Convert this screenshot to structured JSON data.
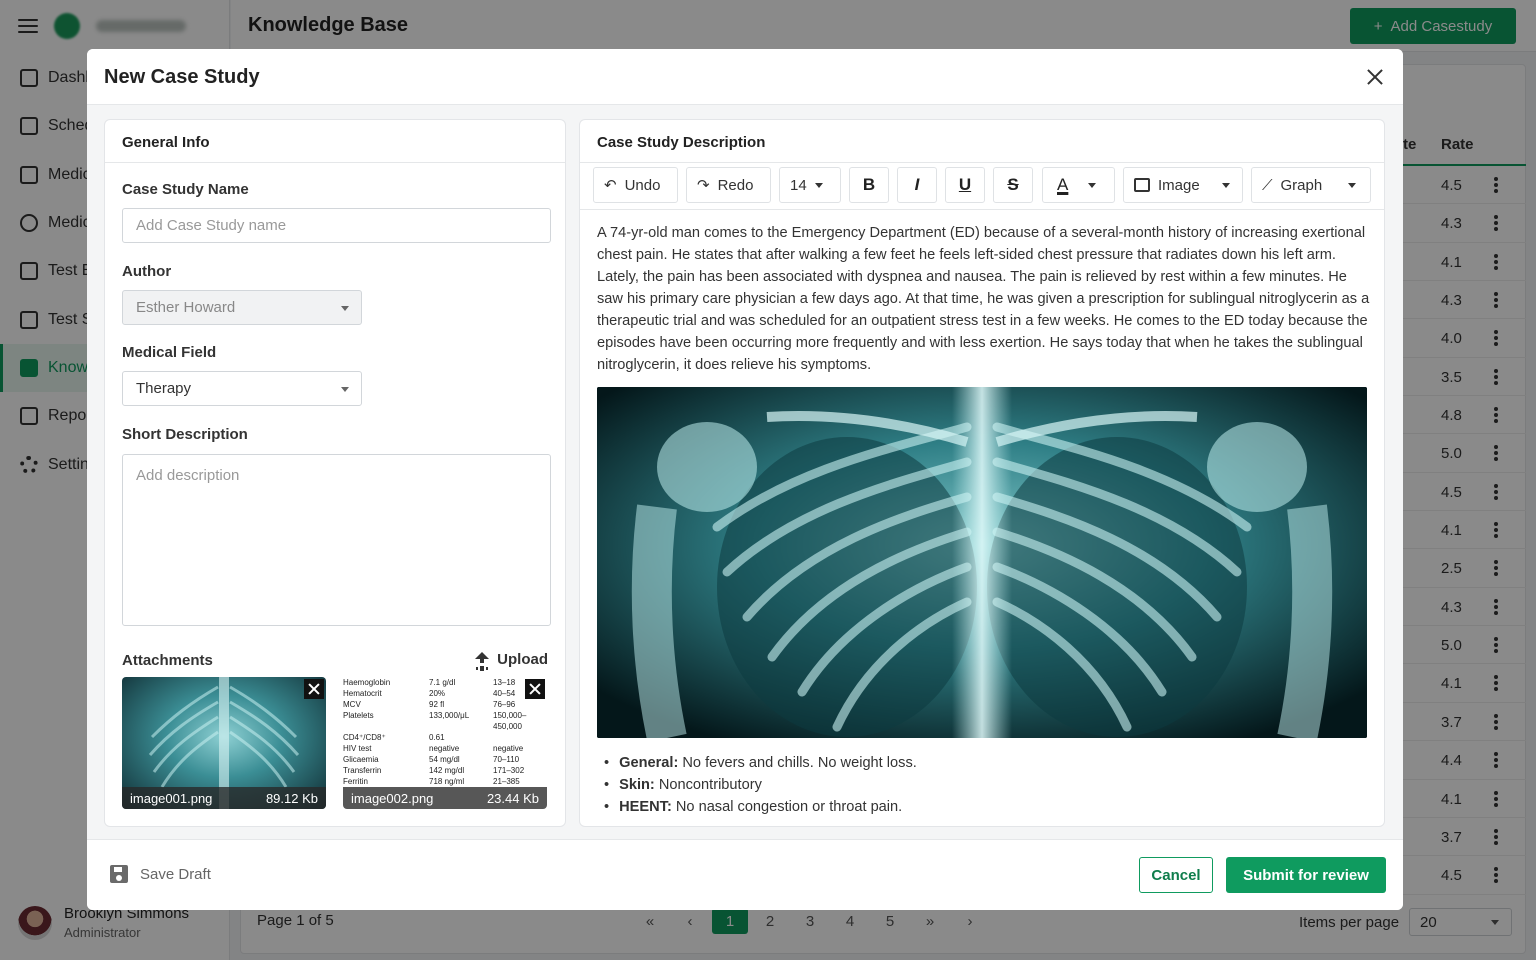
{
  "app": {
    "page_title": "Knowledge Base",
    "add_button": "Add Casestudy",
    "sidebar": {
      "items": [
        {
          "label": "Dashb",
          "icon": "dashboard-icon"
        },
        {
          "label": "Sched",
          "icon": "calendar-icon"
        },
        {
          "label": "Medic",
          "icon": "book-icon"
        },
        {
          "label": "Medic",
          "icon": "people-icon"
        },
        {
          "label": "Test E",
          "icon": "checklist-icon"
        },
        {
          "label": "Test S",
          "icon": "list-icon"
        },
        {
          "label": "Know",
          "icon": "knowledge-icon"
        },
        {
          "label": "Repor",
          "icon": "report-icon"
        },
        {
          "label": "Settin",
          "icon": "gear-icon"
        }
      ],
      "active_index": 6
    },
    "user": {
      "name": "Brooklyn Simmons",
      "role": "Administrator"
    },
    "table": {
      "col_partial": "te",
      "col_rate": "Rate",
      "rates": [
        "4.5",
        "4.3",
        "4.1",
        "4.3",
        "4.0",
        "3.5",
        "4.8",
        "5.0",
        "4.5",
        "4.1",
        "2.5",
        "4.3",
        "5.0",
        "4.1",
        "3.7",
        "4.4",
        "4.1",
        "3.7",
        "4.5"
      ]
    },
    "pager": {
      "text": "Page 1 of 5",
      "first": "«",
      "prev": "‹",
      "pages": [
        "1",
        "2",
        "3",
        "4",
        "5"
      ],
      "next_many": "»",
      "next": "›",
      "items_per_page_label": "Items per page",
      "items_per_page": "20"
    }
  },
  "modal": {
    "title": "New Case Study",
    "general": {
      "header": "General Info",
      "name_label": "Case Study Name",
      "name_placeholder": "Add Case Study name",
      "author_label": "Author",
      "author_value": "Esther Howard",
      "field_label": "Medical Field",
      "field_value": "Therapy",
      "short_label": "Short Description",
      "short_placeholder": "Add description",
      "attachments_label": "Attachments",
      "upload_label": "Upload",
      "attachments": [
        {
          "name": "image001.png",
          "size": "89.12 Kb"
        },
        {
          "name": "image002.png",
          "size": "23.44 Kb"
        }
      ],
      "lab_sheet": {
        "names": [
          "Haemoglobin",
          "Hematocrit",
          "MCV",
          "Platelets",
          "",
          "CD4⁺/CD8⁺",
          "HIV test",
          "Glicaemia",
          "Transferrin",
          "Ferritin"
        ],
        "values": [
          "7.1 g/dl",
          "20%",
          "92 fl",
          "133,000/μL",
          "",
          "0.61",
          "negative",
          "54 mg/dl",
          "142 mg/dl",
          "718 ng/ml"
        ],
        "ranges": [
          "13–18",
          "40–54",
          "76–96",
          "150,000–",
          "450,000",
          "",
          "negative",
          "70–110",
          "171–302",
          "21–385"
        ]
      }
    },
    "description": {
      "header": "Case Study Description",
      "toolbar": {
        "undo": "Undo",
        "redo": "Redo",
        "font_size": "14",
        "bold": "B",
        "italic": "I",
        "underline": "U",
        "strike": "S",
        "color": "A",
        "image": "Image",
        "graph": "Graph"
      },
      "paragraph": "A 74-yr-old man comes to the Emergency Department (ED) because of a several-month history of increasing exertional chest pain. He states that after walking a few feet he feels left-sided chest pressure that radiates down his left arm. Lately, the pain has been associated with dyspnea and nausea. The pain is relieved by rest within a few minutes. He saw his primary care physician a few days ago. At that time, he was given a prescription for sublingual nitroglycerin as a therapeutic trial and was scheduled for an outpatient stress test in a few weeks. He comes to the ED today because the episodes have been occurring more frequently and with less exertion. He says today that when he takes the sublingual nitroglycerin, it does relieve his symptoms.",
      "bullets": [
        {
          "key": "General:",
          "text": " No fevers and chills. No weight loss."
        },
        {
          "key": "Skin:",
          "text": " Noncontributory"
        },
        {
          "key": "HEENT:",
          "text": " No nasal congestion or throat pain."
        }
      ]
    },
    "footer": {
      "save_draft": "Save Draft",
      "cancel": "Cancel",
      "submit": "Submit for review"
    }
  },
  "colors": {
    "accent": "#0f9b5f",
    "overlay": "rgba(0,0,0,0.46)",
    "xray_tint": "#7fc6c8"
  }
}
